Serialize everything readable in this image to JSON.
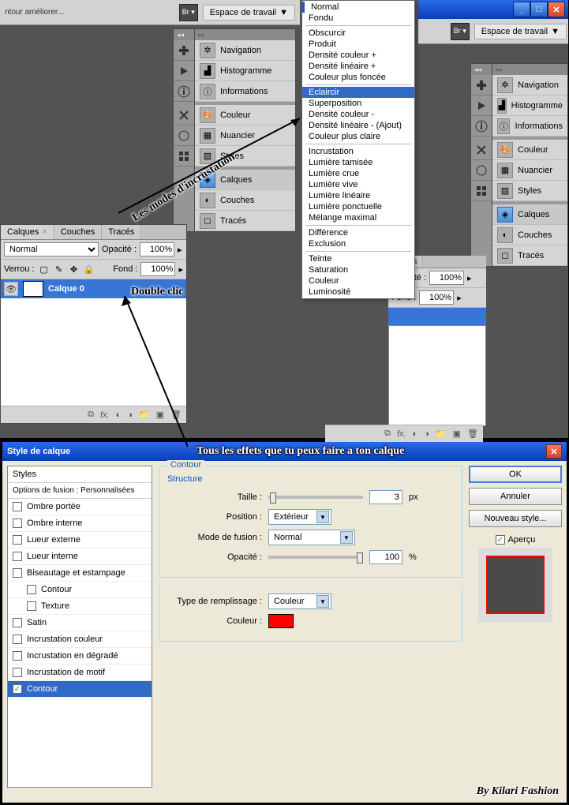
{
  "toolbar": {
    "workspace_label": "Espace de travail",
    "improve_text": "ntour améliorer..."
  },
  "panels": {
    "nav": "Navigation",
    "hist": "Histogramme",
    "info": "Informations",
    "color": "Couleur",
    "swatch": "Nuancier",
    "styles": "Styles",
    "layers": "Calques",
    "channels": "Couches",
    "paths": "Tracés"
  },
  "layers_panel": {
    "tab_layers": "Calques",
    "tab_channels": "Couches",
    "tab_paths": "Tracés",
    "blend_normal": "Normal",
    "opacity_label": "Opacité :",
    "opacity_value": "100%",
    "lock_label": "Verrou :",
    "fill_label": "Fond :",
    "fill_value": "100%",
    "layer0": "Calque 0"
  },
  "blend_modes": {
    "g1": [
      "Normal",
      "Fondu"
    ],
    "g2": [
      "Obscurcir",
      "Produit",
      "Densité couleur +",
      "Densité linéaire +",
      "Couleur plus foncée"
    ],
    "g3": [
      "Eclaircir",
      "Superposition",
      "Densité couleur -",
      "Densité linéaire - (Ajout)",
      "Couleur plus claire"
    ],
    "g4": [
      "Incrustation",
      "Lumière tamisée",
      "Lumière crue",
      "Lumière vive",
      "Lumière linéaire",
      "Lumière ponctuelle",
      "Mélange maximal"
    ],
    "g5": [
      "Différence",
      "Exclusion"
    ],
    "g6": [
      "Teinte",
      "Saturation",
      "Couleur",
      "Luminosité"
    ],
    "selected": "Eclaircir"
  },
  "annotations": {
    "modes": "Les modes d'incrustation",
    "dblclick": "Double clic",
    "effects": "Tous les effets que tu peux faire a ton calque",
    "credit": "By Kilari Fashion"
  },
  "dialog": {
    "title": "Style de calque",
    "styles_hdr": "Styles",
    "blend_opts": "Options de fusion : Personnalisées",
    "items": [
      {
        "label": "Ombre portée",
        "checked": false,
        "indent": false
      },
      {
        "label": "Ombre interne",
        "checked": false,
        "indent": false
      },
      {
        "label": "Lueur externe",
        "checked": false,
        "indent": false
      },
      {
        "label": "Lueur interne",
        "checked": false,
        "indent": false
      },
      {
        "label": "Biseautage et estampage",
        "checked": false,
        "indent": false
      },
      {
        "label": "Contour",
        "checked": false,
        "indent": true
      },
      {
        "label": "Texture",
        "checked": false,
        "indent": true
      },
      {
        "label": "Satin",
        "checked": false,
        "indent": false
      },
      {
        "label": "Incrustation couleur",
        "checked": false,
        "indent": false
      },
      {
        "label": "Incrustation en dégradé",
        "checked": false,
        "indent": false
      },
      {
        "label": "Incrustation de motif",
        "checked": false,
        "indent": false
      },
      {
        "label": "Contour",
        "checked": true,
        "indent": false,
        "selected": true
      }
    ],
    "group_contour": "Contour",
    "group_structure": "Structure",
    "size_label": "Taille :",
    "size_value": "3",
    "size_unit": "px",
    "position_label": "Position :",
    "position_value": "Extérieur",
    "blend_label": "Mode de fusion :",
    "blend_value": "Normal",
    "opacity_label": "Opacité :",
    "opacity_value": "100",
    "opacity_unit": "%",
    "fill_type_label": "Type de remplissage :",
    "fill_type_value": "Couleur",
    "color_label": "Couleur :",
    "color_value": "#ff0000",
    "ok": "OK",
    "cancel": "Annuler",
    "new_style": "Nouveau style...",
    "preview": "Aperçu"
  }
}
